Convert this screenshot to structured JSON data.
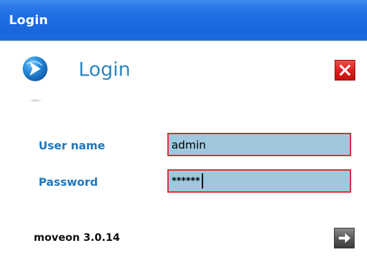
{
  "window": {
    "title": "Login"
  },
  "header": {
    "title": "Login",
    "logo_icon": "chevron-right-bubble-icon",
    "close_icon": "close-icon"
  },
  "form": {
    "username_label": "User name",
    "username_value": "admin",
    "password_label": "Password",
    "password_mask": "******"
  },
  "footer": {
    "version": "moveon 3.0.14",
    "submit_icon": "arrow-right-icon"
  },
  "colors": {
    "titlebar": "#1f6fe3",
    "accent": "#2b86c6",
    "field_bg": "#9fc8de",
    "field_border": "#e0292f",
    "close_bg": "#e01f1f"
  }
}
